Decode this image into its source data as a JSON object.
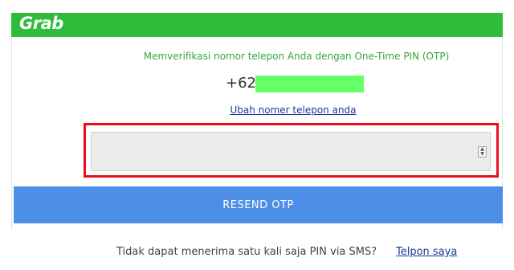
{
  "header": {
    "logo_text": "Grab",
    "brand_color": "#2dbd3a"
  },
  "verification": {
    "subtitle": "Memverifikasi nomor telepon Anda dengan One-Time PIN (OTP)",
    "country_code": "+62",
    "phone_mask_color": "#66ff66",
    "change_phone_link": "Ubah nomer telepon anda"
  },
  "otp_input": {
    "value": "",
    "highlight_color": "#e8101c"
  },
  "resend_button": {
    "label": "RESEND OTP",
    "color": "#4d8fe6"
  },
  "footer": {
    "text": "Tidak dapat menerima satu kali saja PIN via SMS?",
    "call_link": "Telpon saya"
  },
  "icons": {
    "stepper": "number-stepper-icon"
  }
}
